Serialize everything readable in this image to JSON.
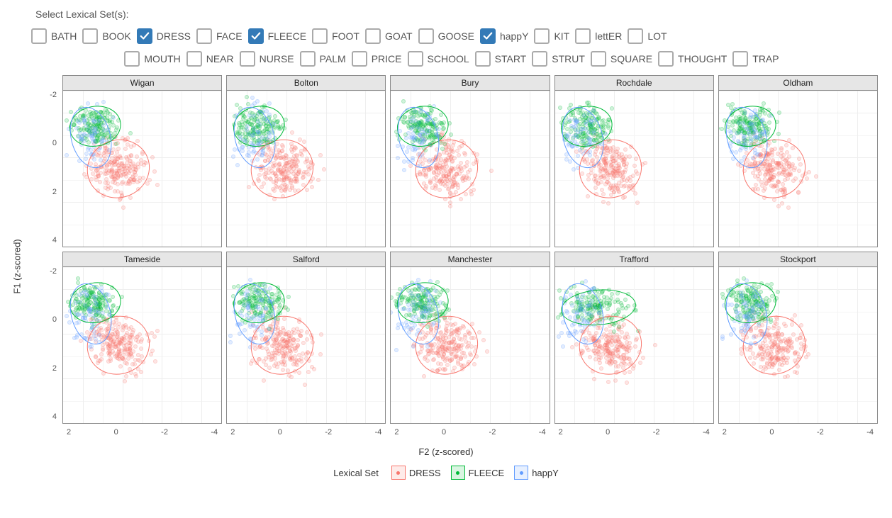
{
  "controls": {
    "title": "Select Lexical Set(s):",
    "row1": [
      {
        "label": "BATH",
        "checked": false
      },
      {
        "label": "BOOK",
        "checked": false
      },
      {
        "label": "DRESS",
        "checked": true
      },
      {
        "label": "FACE",
        "checked": false
      },
      {
        "label": "FLEECE",
        "checked": true
      },
      {
        "label": "FOOT",
        "checked": false
      },
      {
        "label": "GOAT",
        "checked": false
      },
      {
        "label": "GOOSE",
        "checked": false
      },
      {
        "label": "happY",
        "checked": true
      },
      {
        "label": "KIT",
        "checked": false
      },
      {
        "label": "lettER",
        "checked": false
      },
      {
        "label": "LOT",
        "checked": false
      }
    ],
    "row2": [
      {
        "label": "MOUTH",
        "checked": false
      },
      {
        "label": "NEAR",
        "checked": false
      },
      {
        "label": "NURSE",
        "checked": false
      },
      {
        "label": "PALM",
        "checked": false
      },
      {
        "label": "PRICE",
        "checked": false
      },
      {
        "label": "SCHOOL",
        "checked": false
      },
      {
        "label": "START",
        "checked": false
      },
      {
        "label": "STRUT",
        "checked": false
      },
      {
        "label": "SQUARE",
        "checked": false
      },
      {
        "label": "THOUGHT",
        "checked": false
      },
      {
        "label": "TRAP",
        "checked": false
      }
    ]
  },
  "legend": {
    "title": "Lexical Set",
    "items": [
      {
        "label": "DRESS",
        "color": "#F8766D"
      },
      {
        "label": "FLEECE",
        "color": "#00BA38"
      },
      {
        "label": "happY",
        "color": "#619CFF"
      }
    ]
  },
  "axes": {
    "x_title": "F2 (z-scored)",
    "y_title": "F1 (z-scored)",
    "x_ticks": [
      "2",
      "0",
      "-2",
      "-4"
    ],
    "y_ticks": [
      "-2",
      "0",
      "2",
      "4"
    ]
  },
  "chart_data": {
    "type": "scatter",
    "xlabel": "F2 (z-scored)",
    "ylabel": "F1 (z-scored)",
    "x_range": [
      3,
      -5
    ],
    "y_range": [
      -3,
      4
    ],
    "x_reversed": true,
    "facets": [
      "Wigan",
      "Bolton",
      "Bury",
      "Rochdale",
      "Oldham",
      "Tameside",
      "Salford",
      "Manchester",
      "Trafford",
      "Stockport"
    ],
    "series": [
      {
        "name": "DRESS",
        "color": "#F8766D",
        "ellipse_center_f2": 0.2,
        "ellipse_center_f1": 0.5,
        "ellipse_rx": 1.6,
        "ellipse_ry": 1.3,
        "ellipse_angle": -20
      },
      {
        "name": "FLEECE",
        "color": "#00BA38",
        "ellipse_center_f2": 1.4,
        "ellipse_center_f1": -1.4,
        "ellipse_rx": 1.3,
        "ellipse_ry": 0.9,
        "ellipse_angle": -10
      },
      {
        "name": "happY",
        "color": "#619CFF",
        "ellipse_center_f2": 1.6,
        "ellipse_center_f1": -0.9,
        "ellipse_rx": 1.0,
        "ellipse_ry": 1.4,
        "ellipse_angle": -15
      }
    ],
    "facet_overrides": {
      "Trafford": {
        "FLEECE": {
          "ellipse_center_f2": 0.8,
          "ellipse_center_f1": -1.2,
          "ellipse_rx": 1.9,
          "ellipse_ry": 0.8,
          "ellipse_angle": -5
        }
      }
    },
    "note": "Point clouds are dense scatter; ellipses are ~1SD confidence ellipses per series per facet. Axes reversed (high F2 left, low F1 top)."
  }
}
